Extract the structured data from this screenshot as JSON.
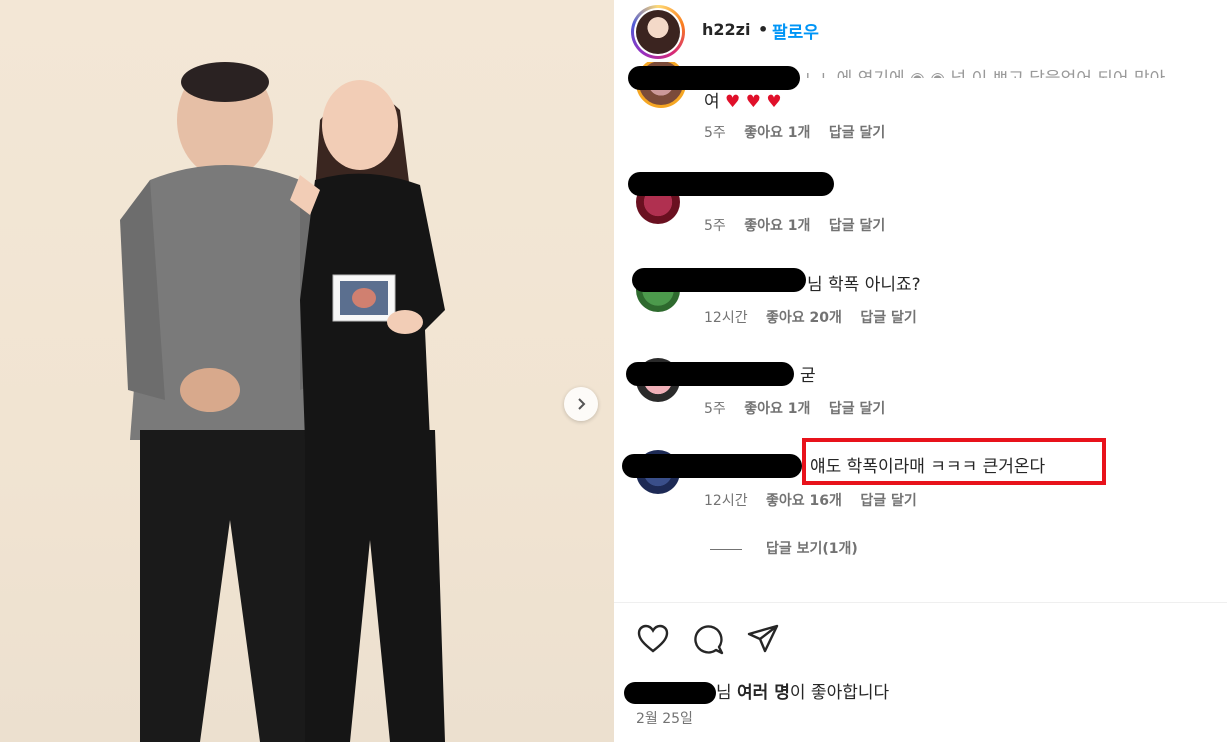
{
  "post": {
    "username": "h22zi",
    "separator": "•",
    "follow_label": "팔로우"
  },
  "comments": [
    {
      "text": "여",
      "time": "5주",
      "likes": "좋아요 1개",
      "reply": "답글 달기"
    },
    {
      "text": "",
      "time": "5주",
      "likes": "좋아요 1개",
      "reply": "답글 달기"
    },
    {
      "text": "님 학폭 아니죠?",
      "time": "12시간",
      "likes": "좋아요 20개",
      "reply": "답글 달기"
    },
    {
      "text": "굳",
      "time": "5주",
      "likes": "좋아요 1개",
      "reply": "답글 달기"
    },
    {
      "text": "얘도 학폭이라매 ㅋㅋㅋ 큰거온다",
      "time": "12시간",
      "likes": "좋아요 16개",
      "reply": "답글 달기"
    }
  ],
  "view_replies": "답글 보기(1개)",
  "likes_line": {
    "suffix_before": "님 ",
    "bold": "여러 명",
    "suffix_after": "이 좋아합니다"
  },
  "date": "2월 25일",
  "icons": {
    "like": "heart-icon",
    "comment": "comment-bubble-icon",
    "share": "paper-plane-icon",
    "next": "chevron-right-icon",
    "hearts": "red-heart-emoji"
  },
  "colors": {
    "follow": "#0095f6",
    "highlight": "#e8121b",
    "heart": "#e0102a"
  }
}
